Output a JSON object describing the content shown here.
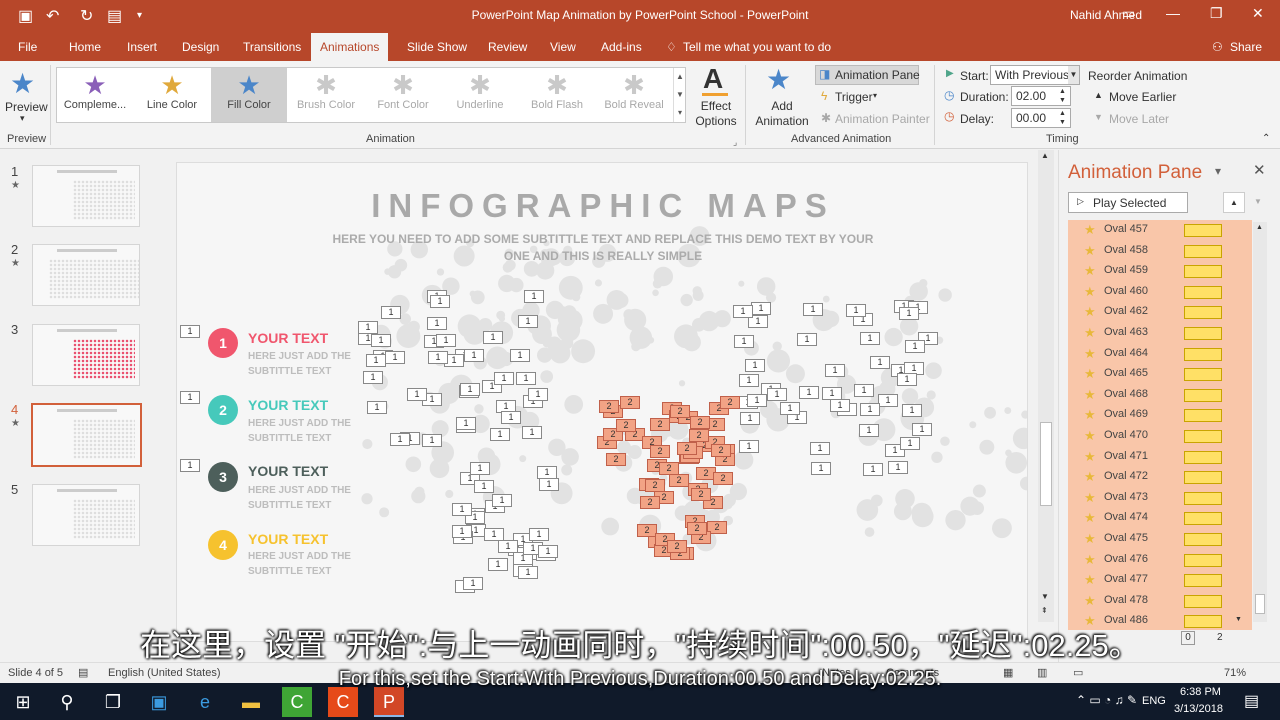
{
  "title_bar": {
    "doc_title": "PowerPoint Map Animation by PowerPoint School  -  PowerPoint",
    "user": "Nahid Ahmed"
  },
  "tabs": [
    {
      "label": "File"
    },
    {
      "label": "Home"
    },
    {
      "label": "Insert"
    },
    {
      "label": "Design"
    },
    {
      "label": "Transitions"
    },
    {
      "label": "Animations"
    },
    {
      "label": "Slide Show"
    },
    {
      "label": "Review"
    },
    {
      "label": "View"
    },
    {
      "label": "Add-ins"
    }
  ],
  "tell_me": "Tell me what you want to do",
  "share": "Share",
  "ribbon": {
    "preview_label": "Preview",
    "preview_group": "Preview",
    "animation_group": "Animation",
    "gallery": [
      {
        "label": "Compleme...",
        "icon": "star-icon",
        "color": "#8a5fb8"
      },
      {
        "label": "Line Color",
        "icon": "star-icon",
        "color": "#e0a93c"
      },
      {
        "label": "Fill Color",
        "icon": "star-icon",
        "color": "#4b86c9"
      },
      {
        "label": "Brush Color",
        "icon": "brush-icon",
        "color": "#b9b9b9"
      },
      {
        "label": "Font Color",
        "icon": "font-icon",
        "color": "#b9b9b9"
      },
      {
        "label": "Underline",
        "icon": "underline-icon",
        "color": "#b9b9b9"
      },
      {
        "label": "Bold Flash",
        "icon": "bold-icon",
        "color": "#b9b9b9"
      },
      {
        "label": "Bold Reveal",
        "icon": "bold-icon",
        "color": "#b9b9b9"
      }
    ],
    "effect_options": "Effect Options",
    "add_animation": "Add Animation",
    "animation_pane": "Animation Pane",
    "trigger": "Trigger",
    "animation_painter": "Animation Painter",
    "advanced_group": "Advanced Animation",
    "start_label": "Start:",
    "start_value": "With Previous",
    "duration_label": "Duration:",
    "duration_value": "02.00",
    "delay_label": "Delay:",
    "delay_value": "00.00",
    "reorder": "Reorder Animation",
    "move_earlier": "Move Earlier",
    "move_later": "Move Later",
    "timing_group": "Timing"
  },
  "slides": [
    {
      "num": "1",
      "star": "★"
    },
    {
      "num": "2",
      "star": "★"
    },
    {
      "num": "3",
      "star": ""
    },
    {
      "num": "4",
      "star": "★"
    },
    {
      "num": "5",
      "star": ""
    }
  ],
  "slide": {
    "title": "INFOGRAPHIC MAPS",
    "subtitle_1": "HERE YOU NEED TO ADD SOME SUBTITTLE TEXT AND REPLACE THIS DEMO TEXT BY YOUR",
    "subtitle_2": "ONE AND THIS IS REALLY SIMPLE",
    "items": [
      {
        "num": "1",
        "title": "YOUR TEXT",
        "sub": "HERE JUST ADD THE SUBTITTLE TEXT",
        "color": "#f0566d"
      },
      {
        "num": "2",
        "title": "YOUR TEXT",
        "sub": "HERE JUST ADD THE SUBTITTLE TEXT",
        "color": "#46c9bb"
      },
      {
        "num": "3",
        "title": "YOUR TEXT",
        "sub": "HERE JUST ADD THE SUBTITTLE TEXT",
        "color": "#4d5f5b"
      },
      {
        "num": "4",
        "title": "YOUR TEXT",
        "sub": "HERE JUST ADD THE SUBTITTLE TEXT",
        "color": "#f6c22e"
      }
    ],
    "tag_1": "1",
    "tag_2": "2"
  },
  "animation_pane": {
    "title": "Animation Pane",
    "play": "Play Selected",
    "items": [
      "Oval 457",
      "Oval 458",
      "Oval 459",
      "Oval 460",
      "Oval 462",
      "Oval 463",
      "Oval 464",
      "Oval 465",
      "Oval 468",
      "Oval 469",
      "Oval 470",
      "Oval 471",
      "Oval 472",
      "Oval 473",
      "Oval 474",
      "Oval 475",
      "Oval 476",
      "Oval 477",
      "Oval 478",
      "Oval 486"
    ],
    "timeline_0": "0",
    "timeline_2": "2"
  },
  "status": {
    "slide": "Slide 4 of 5",
    "language": "English (United States)",
    "notes": "Notes",
    "comments": "Comments",
    "zoom": "71%"
  },
  "taskbar": {
    "time": "6:38 PM",
    "date": "3/13/2018",
    "lang": "ENG"
  },
  "subtitles": {
    "zh": "在这里，设置 \"开始\":与上一动画同时，\"持续时间\":00.50，\"延迟\":02.25。",
    "en": "For this,set the Start:With Previous,Duration:00.50 and Delay:02.25."
  }
}
